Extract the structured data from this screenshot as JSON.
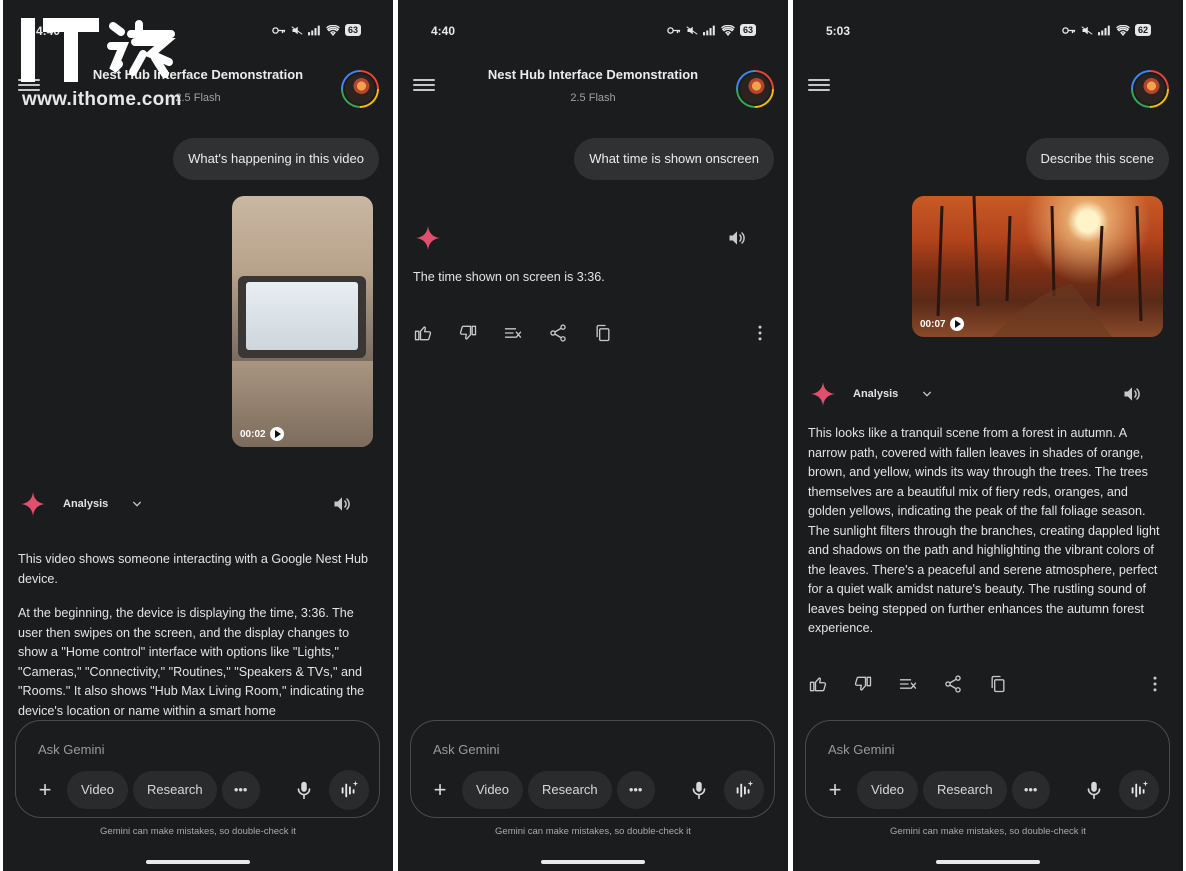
{
  "watermark": {
    "url": "www.ithome.com",
    "logo_text": "IT之家"
  },
  "common": {
    "ask_placeholder": "Ask Gemini",
    "chip_video": "Video",
    "chip_research": "Research",
    "disclaimer": "Gemini can make mistakes, so double-check it",
    "analysis_label": "Analysis"
  },
  "screen1": {
    "time": "4:40",
    "battery": "63",
    "title": "Nest Hub Interface Demonstration",
    "model": "2.5 Flash",
    "prompt": "What's happening in this video",
    "video_duration": "00:02",
    "response_p1": "This video shows someone interacting with a Google Nest Hub device.",
    "response_p2": "At the beginning, the device is displaying the time, 3:36. The user then swipes on the screen, and the display changes to show a \"Home control\" interface with options like \"Lights,\" \"Cameras,\" \"Connectivity,\" \"Routines,\" \"Speakers & TVs,\" and \"Rooms.\" It also shows \"Hub Max Living Room,\" indicating the device's location or name within a smart home"
  },
  "screen2": {
    "time": "4:40",
    "battery": "63",
    "title": "Nest Hub Interface Demonstration",
    "model": "2.5 Flash",
    "prompt": "What time is shown onscreen",
    "response": "The time shown on screen is 3:36."
  },
  "screen3": {
    "time": "5:03",
    "battery": "62",
    "prompt": "Describe this scene",
    "video_duration": "00:07",
    "response": "This looks like a tranquil scene from a forest in autumn. A narrow path, covered with fallen leaves in shades of orange, brown, and yellow, winds its way through the trees. The trees themselves are a beautiful mix of fiery reds, oranges, and golden yellows, indicating the peak of the fall foliage season. The sunlight filters through the branches, creating dappled light and shadows on the path and highlighting the vibrant colors of the leaves. There's a peaceful and serene atmosphere, perfect for a quiet walk amidst nature's beauty. The rustling sound of leaves being stepped on further enhances the autumn forest experience."
  },
  "colors": {
    "background": "#1b1c1e",
    "bubble": "#2f3133",
    "gemini_spark": "#e0506e"
  },
  "icons": [
    "menu-icon",
    "thumbs-up-icon",
    "thumbs-down-icon",
    "modify-response-icon",
    "share-icon",
    "copy-icon",
    "more-vert-icon",
    "speaker-icon",
    "mic-icon",
    "live-icon",
    "gemini-spark-icon",
    "chevron-down-icon",
    "play-icon",
    "plus-icon"
  ]
}
